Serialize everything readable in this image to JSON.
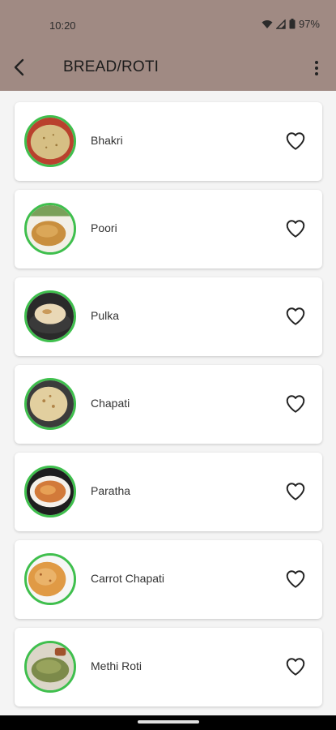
{
  "status_bar": {
    "time": "10:20",
    "battery": "97%"
  },
  "toolbar": {
    "title": "BREAD/ROTI"
  },
  "colors": {
    "appbar": "#a08a83",
    "thumb_border": "#3fbf4d"
  },
  "items": [
    {
      "name": "Bhakri"
    },
    {
      "name": "Poori"
    },
    {
      "name": "Pulka"
    },
    {
      "name": "Chapati"
    },
    {
      "name": "Paratha"
    },
    {
      "name": "Carrot Chapati"
    },
    {
      "name": "Methi Roti"
    }
  ]
}
